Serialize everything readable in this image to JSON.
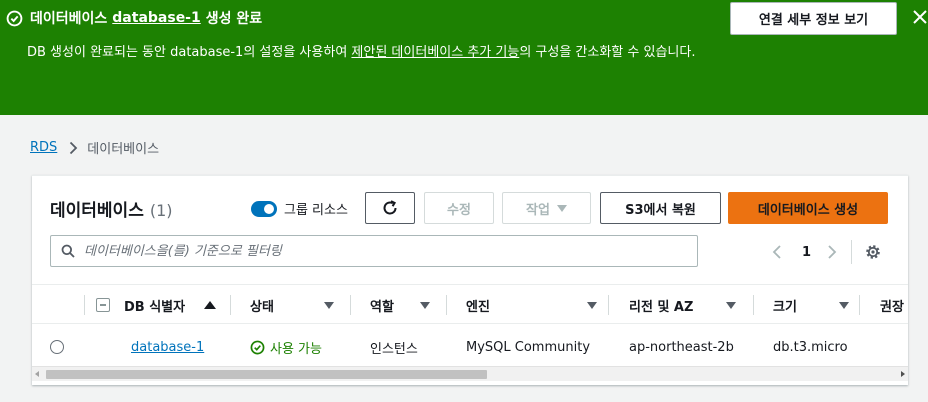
{
  "banner": {
    "title_prefix": "데이터베이스",
    "db_name": "database-1",
    "title_suffix": "생성 완료",
    "message_part1": "DB 생성이 완료되는 동안 database-1의 설정을 사용하여 ",
    "message_link": "제안된 데이터베이스 추가 기능",
    "message_part2": "의 구성을 간소화할 수 있습니다.",
    "connect_button": "연결 세부 정보 보기",
    "icons": {
      "status": "check-circle-icon",
      "close": "close-icon"
    },
    "background_color": "#1d8102"
  },
  "breadcrumb": {
    "root": "RDS",
    "current": "데이터베이스"
  },
  "panel": {
    "title": "데이터베이스",
    "count": "(1)",
    "group_resources_label": "그룹 리소스",
    "group_resources_on": true,
    "buttons": {
      "edit": "수정",
      "actions": "작업",
      "restore_s3": "S3에서 복원",
      "create": "데이터베이스 생성"
    },
    "filter_placeholder": "데이터베이스을(를) 기준으로 필터링",
    "page": "1",
    "accent_color": "#ec7211"
  },
  "table": {
    "columns": [
      "DB 식별자",
      "상태",
      "역할",
      "엔진",
      "리전 및 AZ",
      "크기",
      "권장"
    ],
    "rows": [
      {
        "db_id": "database-1",
        "status": "사용 가능",
        "role": "인스턴스",
        "engine": "MySQL Community",
        "region_az": "ap-northeast-2b",
        "size": "db.t3.micro"
      }
    ]
  }
}
